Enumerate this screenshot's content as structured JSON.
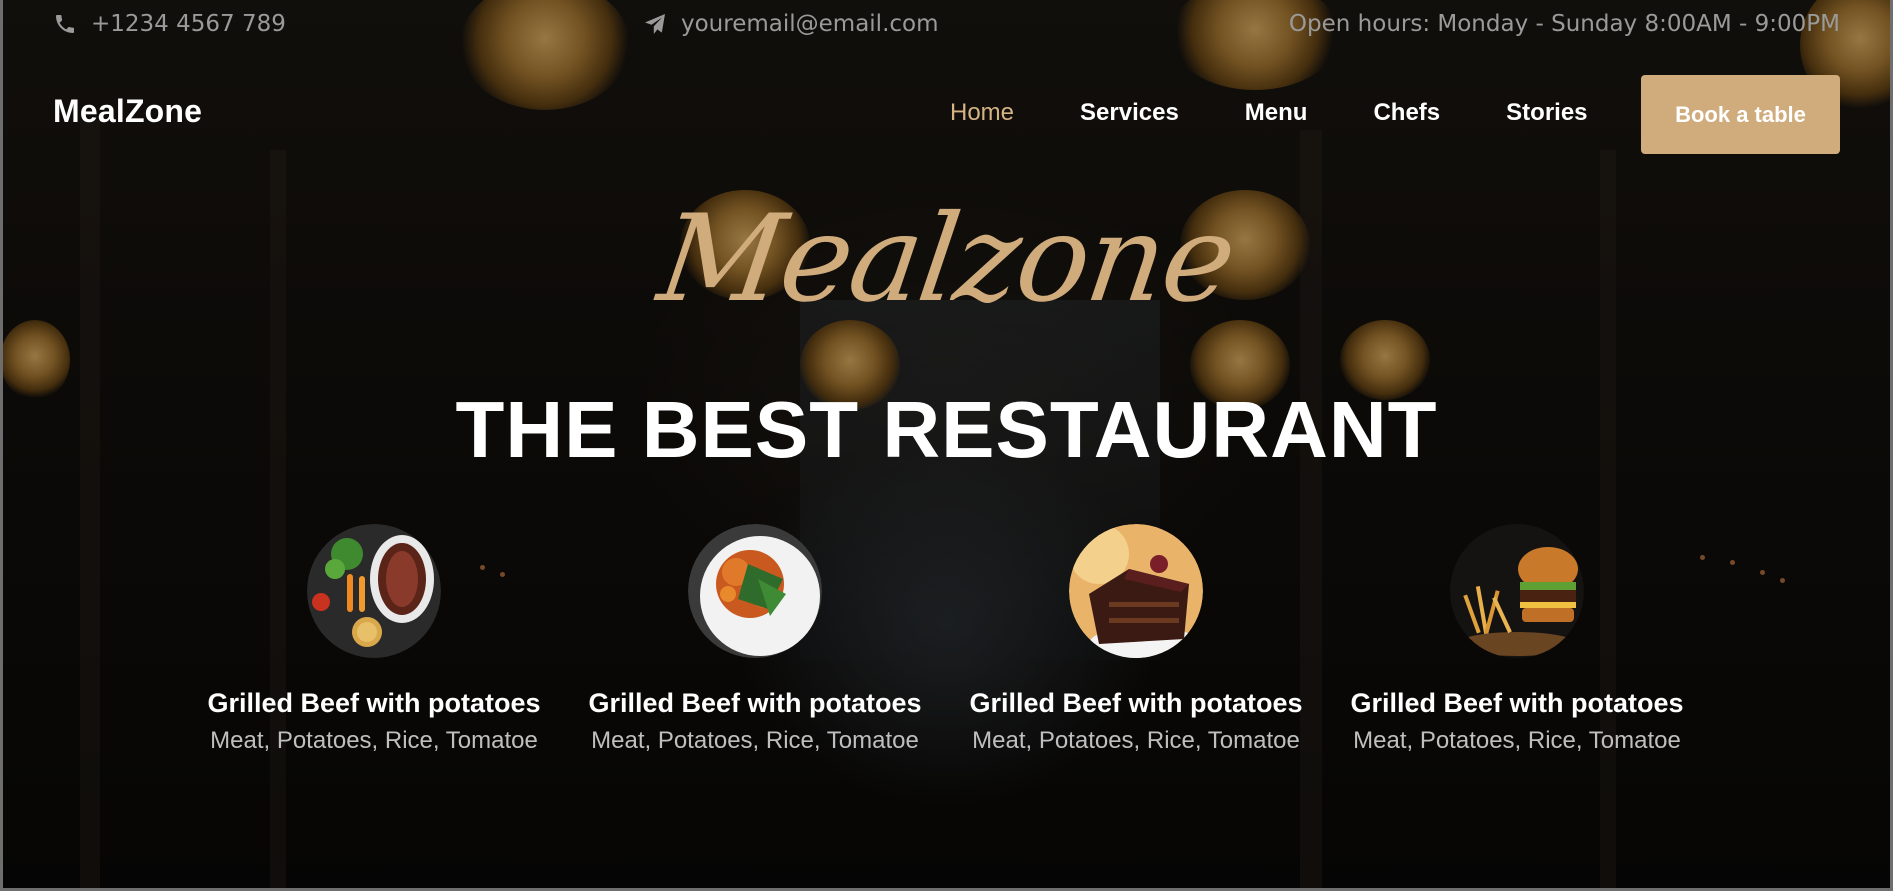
{
  "topbar": {
    "phone": "+1234 4567 789",
    "email": "youremail@email.com",
    "hours": "Open hours: Monday - Sunday 8:00AM - 9:00PM"
  },
  "brand": "MealZone",
  "nav": {
    "items": [
      "Home",
      "Services",
      "Menu",
      "Chefs",
      "Stories"
    ],
    "active": "Home",
    "cta": "Book a table"
  },
  "hero": {
    "script_title": "Mealzone",
    "headline": "THE BEST RESTAURANT"
  },
  "dishes": [
    {
      "name": "Grilled Beef with potatoes",
      "ingredients": "Meat, Potatoes, Rice, Tomatoe",
      "image": "steak-vegetables-plate"
    },
    {
      "name": "Grilled Beef with potatoes",
      "ingredients": "Meat, Potatoes, Rice, Tomatoe",
      "image": "chicken-salad-plate"
    },
    {
      "name": "Grilled Beef with potatoes",
      "ingredients": "Meat, Potatoes, Rice, Tomatoe",
      "image": "chocolate-cake-slice"
    },
    {
      "name": "Grilled Beef with potatoes",
      "ingredients": "Meat, Potatoes, Rice, Tomatoe",
      "image": "burger-and-fries"
    }
  ],
  "colors": {
    "accent": "#d0ab7c",
    "nav_active": "#d4b483",
    "topbar_text": "#9a9a9a"
  }
}
